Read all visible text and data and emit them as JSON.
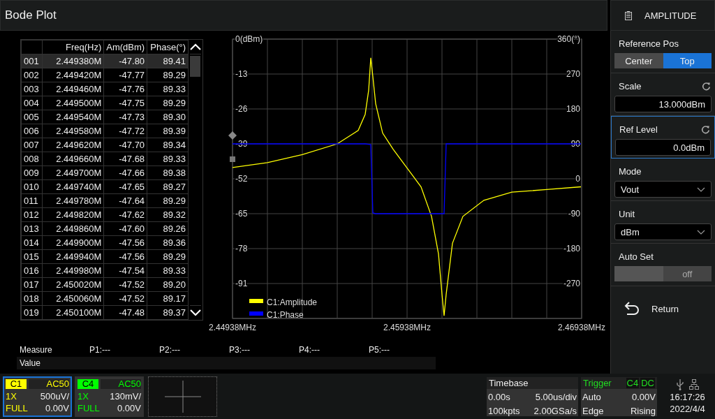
{
  "title": "Bode Plot",
  "table": {
    "columns": [
      "Freq(Hz)",
      "Am(dBm)",
      "Phase(°)"
    ],
    "rows": [
      {
        "index": "001",
        "freq": "2.449380M",
        "am": "-47.80",
        "phase": "89.41",
        "selected": true
      },
      {
        "index": "002",
        "freq": "2.449420M",
        "am": "-47.77",
        "phase": "89.29",
        "selected": false
      },
      {
        "index": "003",
        "freq": "2.449460M",
        "am": "-47.76",
        "phase": "89.33",
        "selected": false
      },
      {
        "index": "004",
        "freq": "2.449500M",
        "am": "-47.75",
        "phase": "89.29",
        "selected": false
      },
      {
        "index": "005",
        "freq": "2.449540M",
        "am": "-47.73",
        "phase": "89.30",
        "selected": false
      },
      {
        "index": "006",
        "freq": "2.449580M",
        "am": "-47.72",
        "phase": "89.39",
        "selected": false
      },
      {
        "index": "007",
        "freq": "2.449620M",
        "am": "-47.70",
        "phase": "89.34",
        "selected": false
      },
      {
        "index": "008",
        "freq": "2.449660M",
        "am": "-47.68",
        "phase": "89.33",
        "selected": false
      },
      {
        "index": "009",
        "freq": "2.449700M",
        "am": "-47.66",
        "phase": "89.38",
        "selected": false
      },
      {
        "index": "010",
        "freq": "2.449740M",
        "am": "-47.65",
        "phase": "89.27",
        "selected": false
      },
      {
        "index": "011",
        "freq": "2.449780M",
        "am": "-47.64",
        "phase": "89.29",
        "selected": false
      },
      {
        "index": "012",
        "freq": "2.449820M",
        "am": "-47.62",
        "phase": "89.32",
        "selected": false
      },
      {
        "index": "013",
        "freq": "2.449860M",
        "am": "-47.60",
        "phase": "89.26",
        "selected": false
      },
      {
        "index": "014",
        "freq": "2.449900M",
        "am": "-47.56",
        "phase": "89.36",
        "selected": false
      },
      {
        "index": "015",
        "freq": "2.449940M",
        "am": "-47.56",
        "phase": "89.29",
        "selected": false
      },
      {
        "index": "016",
        "freq": "2.449980M",
        "am": "-47.54",
        "phase": "89.33",
        "selected": false
      },
      {
        "index": "017",
        "freq": "2.450020M",
        "am": "-47.52",
        "phase": "89.20",
        "selected": false
      },
      {
        "index": "018",
        "freq": "2.450060M",
        "am": "-47.52",
        "phase": "89.17",
        "selected": false
      },
      {
        "index": "019",
        "freq": "2.450100M",
        "am": "-47.48",
        "phase": "89.37",
        "selected": false
      }
    ]
  },
  "chart_data": {
    "type": "line",
    "x": [
      2.44938,
      2.45138,
      2.45338,
      2.45538,
      2.45658,
      2.45698,
      2.45718,
      2.4573,
      2.45742,
      2.45758,
      2.45798,
      2.45858,
      2.45938,
      2.46018,
      2.46078,
      2.46118,
      2.46138,
      2.4615,
      2.46162,
      2.46198,
      2.46258,
      2.46378,
      2.46538,
      2.46738,
      2.46934
    ],
    "series": [
      {
        "name": "C1:Amplitude",
        "color": "#ffff00",
        "values": [
          -47.8,
          -46,
          -43,
          -39,
          -34,
          -28,
          -19,
          -7,
          -14,
          -24,
          -35,
          -41,
          -48,
          -55,
          -66,
          -80,
          -95,
          -103,
          -95,
          -76,
          -66,
          -60,
          -57,
          -56,
          -55
        ]
      },
      {
        "name": "C1:Phase",
        "color": "#0000ff",
        "axis": "y2",
        "values": [
          90,
          90,
          90,
          90,
          90,
          90,
          89,
          88,
          -88,
          -90,
          -90,
          -90,
          -90,
          -90,
          -90,
          -90,
          -90,
          -90,
          90,
          90,
          90,
          90,
          90,
          90,
          90
        ]
      }
    ],
    "grid": true,
    "legend": true,
    "xlim": [
      2.44938,
      2.46938
    ],
    "ylim": [
      -104,
      0
    ],
    "xticks": [
      {
        "value": 2.44938,
        "label": "2.44938MHz"
      },
      {
        "value": 2.45938,
        "label": "2.45938MHz"
      },
      {
        "value": 2.46938,
        "label": "2.46938MHz"
      }
    ],
    "yticks": [
      {
        "value": 0,
        "label": "0(dBm)"
      },
      -13,
      -26,
      -39,
      -52,
      -65,
      -78,
      -91
    ],
    "y2lim": [
      -360,
      360
    ],
    "y2ticks": [
      {
        "value": 360,
        "label": "360(°)"
      },
      270,
      180,
      90,
      0,
      -90,
      -180,
      -270
    ]
  },
  "measure": {
    "label": "Measure",
    "items": [
      "P1:---",
      "P2:---",
      "P3:---",
      "P4:---",
      "P5:---"
    ],
    "value_label": "Value"
  },
  "panel": {
    "title": "AMPLITUDE",
    "controls": [
      {
        "kind": "segmented",
        "label": "Reference Pos",
        "options": [
          {
            "label": "Center",
            "selected": false
          },
          {
            "label": "Top",
            "selected": true
          }
        ]
      },
      {
        "kind": "numeric",
        "label": "Scale",
        "value": "13.000dBm",
        "focused": false
      },
      {
        "kind": "numeric",
        "label": "Ref Level",
        "value": "0.0dBm",
        "focused": true
      },
      {
        "kind": "dropdown",
        "label": "Mode",
        "value": "Vout"
      },
      {
        "kind": "dropdown",
        "label": "Unit",
        "value": "dBm"
      },
      {
        "kind": "toggle",
        "label": "Auto Set",
        "value": "off",
        "on": false
      }
    ],
    "return_label": "Return"
  },
  "channels": [
    {
      "name": "C1",
      "coupling": "AC50",
      "probe": "1X",
      "scale": "500uV/",
      "bandwidth": "FULL",
      "offset": "0.00V",
      "color": "#ffff00",
      "selected": true
    },
    {
      "name": "C4",
      "coupling": "AC50",
      "probe": "1X",
      "scale": "130mV/",
      "bandwidth": "FULL",
      "offset": "0.00V",
      "color": "#00ff00",
      "selected": false
    }
  ],
  "timebase": {
    "title": "Timebase",
    "delay": "0.00s",
    "scale": "5.00us/div",
    "depth": "100kpts",
    "rate": "2.00GSa/s"
  },
  "trigger": {
    "title": "Trigger",
    "source": "C4",
    "coupling": "DC",
    "mode": "Auto",
    "level": "0.00V",
    "type": "Edge",
    "slope": "Rising"
  },
  "status": {
    "time": "16:17:26",
    "date": "2022/4/4"
  }
}
